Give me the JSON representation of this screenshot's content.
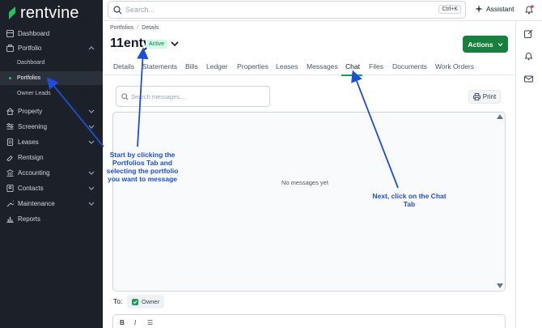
{
  "app": {
    "logo_text": "rentvine"
  },
  "topbar": {
    "search_placeholder": "Search...",
    "shortcut": "Ctrl+K",
    "assistant_label": "Assistant"
  },
  "sidebar": {
    "items": [
      {
        "label": "Dashboard",
        "icon": "grid-icon"
      },
      {
        "label": "Portfolio",
        "icon": "briefcase-icon"
      },
      {
        "label": "Property",
        "icon": "home-icon"
      },
      {
        "label": "Screening",
        "icon": "screening-icon"
      },
      {
        "label": "Leases",
        "icon": "document-icon"
      },
      {
        "label": "Rentsign",
        "icon": "signature-icon"
      },
      {
        "label": "Accounting",
        "icon": "bank-icon"
      },
      {
        "label": "Contacts",
        "icon": "contacts-icon"
      },
      {
        "label": "Maintenance",
        "icon": "wrench-icon"
      },
      {
        "label": "Reports",
        "icon": "chart-icon"
      }
    ],
    "portfolio_sub": [
      "Dashboard",
      "Portfolios",
      "Owner Leads"
    ]
  },
  "breadcrumb": {
    "root": "Portfolios",
    "separator": "/",
    "current": "Details"
  },
  "portfolio": {
    "name": "11enty",
    "status": "Active"
  },
  "actions_label": "Actions",
  "tabs": [
    "Details",
    "Statements",
    "Bills",
    "Ledger",
    "Properties",
    "Leases",
    "Messages",
    "Chat",
    "Files",
    "Documents",
    "Work Orders"
  ],
  "active_tab": "Chat",
  "chat": {
    "search_placeholder": "Search messages...",
    "print_label": "Print",
    "empty_text": "No messages yet",
    "to_label": "To:",
    "recipient": "Owner",
    "editor_buttons": [
      "B",
      "I",
      "☰"
    ]
  },
  "annotations": {
    "left": "Start by clicking the Portfolios Tab and selecting the portfolio you want to message",
    "right": "Next, click on the Chat Tab"
  },
  "colors": {
    "sidebar_bg": "#1c2129",
    "accent_green": "#16803c",
    "annotation_blue": "#1d4ed8"
  }
}
